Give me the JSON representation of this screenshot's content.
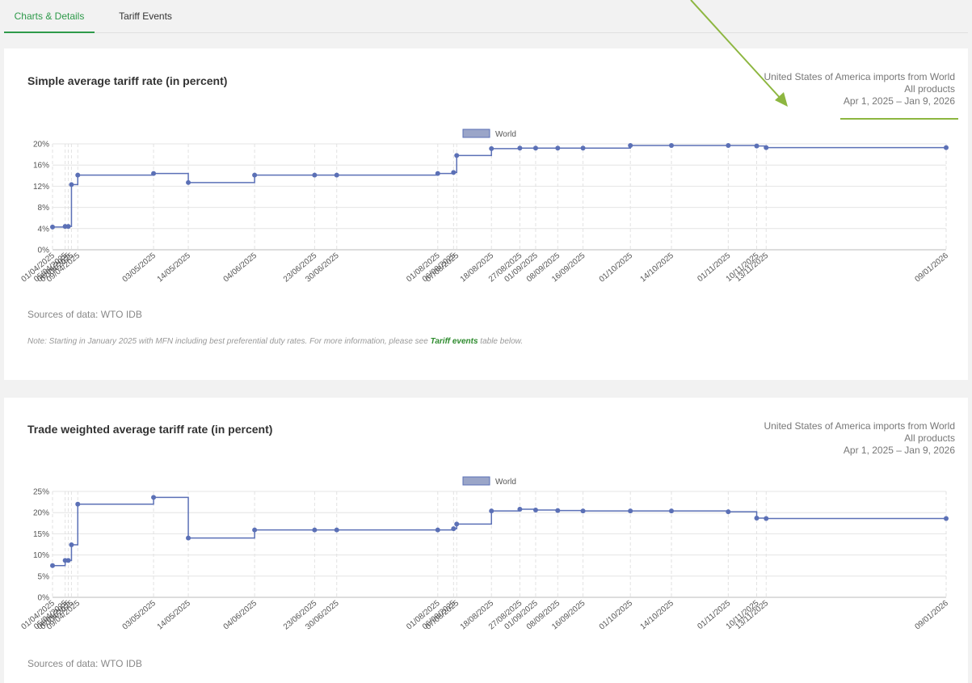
{
  "tabs": [
    {
      "label": "Charts & Details"
    },
    {
      "label": "Tariff Events"
    }
  ],
  "colors": {
    "accent": "#2e9a4a",
    "series": "#5b70b6",
    "annotation_arrow": "#8db640"
  },
  "card1": {
    "title": "Simple average tariff rate (in percent)",
    "meta_line1": "United States of America imports from World",
    "meta_line2": "All products",
    "meta_line3": "Apr 1, 2025 – Jan 9, 2026",
    "source": "Sources of data: WTO IDB",
    "note_prefix": "Note: Starting in January 2025 with MFN including best preferential duty rates. For more information, please see ",
    "note_link": "Tariff events",
    "note_suffix": " table below."
  },
  "card2": {
    "title": "Trade weighted average tariff rate (in percent)",
    "meta_line1": "United States of America imports from World",
    "meta_line2": "All products",
    "meta_line3": "Apr 1, 2025 – Jan 9, 2026",
    "source": "Sources of data: WTO IDB"
  },
  "chart_data": [
    {
      "type": "line",
      "step": true,
      "title": "Simple average tariff rate (in percent)",
      "legend": "World",
      "legend_position": "top",
      "grid": true,
      "ylim": [
        0,
        20
      ],
      "yticks": [
        "0%",
        "4%",
        "8%",
        "12%",
        "16%",
        "20%"
      ],
      "ytick_values": [
        0,
        4,
        8,
        12,
        16,
        20
      ],
      "x": [
        "01/04/2025",
        "05/04/2025",
        "06/04/2025",
        "07/04/2025",
        "09/04/2025",
        "03/05/2025",
        "14/05/2025",
        "04/06/2025",
        "23/06/2025",
        "30/06/2025",
        "01/08/2025",
        "06/08/2025",
        "07/08/2025",
        "18/08/2025",
        "27/08/2025",
        "01/09/2025",
        "08/09/2025",
        "16/09/2025",
        "01/10/2025",
        "14/10/2025",
        "01/11/2025",
        "10/11/2025",
        "13/11/2025",
        "09/01/2026"
      ],
      "series": [
        {
          "name": "World",
          "values": [
            4.3,
            4.4,
            4.4,
            12.3,
            14.1,
            14.4,
            12.7,
            14.1,
            14.1,
            14.1,
            14.4,
            14.6,
            17.8,
            19.1,
            19.2,
            19.2,
            19.2,
            19.2,
            19.7,
            19.7,
            19.7,
            19.6,
            19.3,
            19.3
          ]
        }
      ]
    },
    {
      "type": "line",
      "step": true,
      "title": "Trade weighted average tariff rate (in percent)",
      "legend": "World",
      "legend_position": "top",
      "grid": true,
      "ylim": [
        0,
        25
      ],
      "yticks": [
        "0%",
        "5%",
        "10%",
        "15%",
        "20%",
        "25%"
      ],
      "ytick_values": [
        0,
        5,
        10,
        15,
        20,
        25
      ],
      "x": [
        "01/04/2025",
        "05/04/2025",
        "06/04/2025",
        "07/04/2025",
        "09/04/2025",
        "03/05/2025",
        "14/05/2025",
        "04/06/2025",
        "23/06/2025",
        "30/06/2025",
        "01/08/2025",
        "06/08/2025",
        "07/08/2025",
        "18/08/2025",
        "27/08/2025",
        "01/09/2025",
        "08/09/2025",
        "16/09/2025",
        "01/10/2025",
        "14/10/2025",
        "01/11/2025",
        "10/11/2025",
        "13/11/2025",
        "09/01/2026"
      ],
      "series": [
        {
          "name": "World",
          "values": [
            7.5,
            8.7,
            8.7,
            12.4,
            22.0,
            23.6,
            14.0,
            15.9,
            15.9,
            15.9,
            15.9,
            16.2,
            17.3,
            20.4,
            20.8,
            20.6,
            20.5,
            20.4,
            20.4,
            20.4,
            20.2,
            18.7,
            18.6,
            18.6
          ]
        }
      ]
    }
  ]
}
